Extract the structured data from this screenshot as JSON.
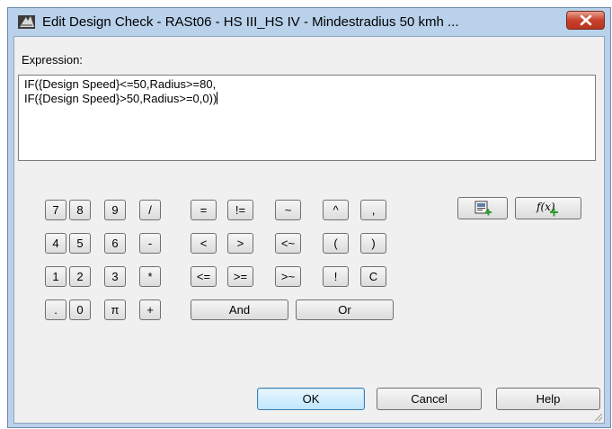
{
  "window": {
    "title": "Edit Design Check - RASt06 - HS III_HS IV - Mindestradius 50 kmh ..."
  },
  "expression": {
    "label": "Expression:",
    "line1": "IF({Design Speed}<=50,Radius>=80,",
    "line2": "IF({Design Speed}>50,Radius>=0,0))"
  },
  "keypad": {
    "k7": "7",
    "k8": "8",
    "k9": "9",
    "kdiv": "/",
    "k4": "4",
    "k5": "5",
    "k6": "6",
    "kminus": "-",
    "k1": "1",
    "k2": "2",
    "k3": "3",
    "kmul": "*",
    "kdot": ".",
    "k0": "0",
    "kpi": "π",
    "kplus": "+",
    "keq": "=",
    "kneq": "!=",
    "ktilde": "~",
    "kcaret": "^",
    "kcomma": ",",
    "klt": "<",
    "kgt": ">",
    "kltt": "<~",
    "klparen": "(",
    "krparen": ")",
    "kle": "<=",
    "kge": ">=",
    "kgtt": ">~",
    "knot": "!",
    "kclear": "C",
    "kand": "And",
    "kor": "Or"
  },
  "tools": {
    "insert_property_icon": "insert-property-icon",
    "insert_function_icon": "insert-function-icon",
    "function_glyph": "f(x)"
  },
  "buttons": {
    "ok": "OK",
    "cancel": "Cancel",
    "help": "Help"
  },
  "colors": {
    "titlebar": "#b9d1ea",
    "close": "#c7412c",
    "default_button_border": "#3c7fb1"
  }
}
